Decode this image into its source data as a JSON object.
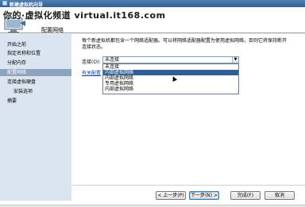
{
  "window": {
    "title": "新建虚拟机向导"
  },
  "header": {
    "title": "配置网络"
  },
  "watermark": {
    "text": "你的·虚拟化频道 virtual.it168.com"
  },
  "sidebar": {
    "items": [
      {
        "label": "开始之前"
      },
      {
        "label": "指定名称和位置"
      },
      {
        "label": "分配内存"
      },
      {
        "label": "配置网络"
      },
      {
        "label": "连接虚拟硬盘"
      },
      {
        "label": "安装选项"
      },
      {
        "label": "摘要"
      }
    ]
  },
  "content": {
    "description": "每个新虚拟机都包含一个网络适配器。可以将网络适配器配置为使用虚拟网络，否则它将保持断开连接状态。",
    "connection_label": "连接(O):",
    "connection_value": "未连接",
    "link_text": "有关配置",
    "dropdown_options": [
      {
        "label": "未连接"
      },
      {
        "label": "内部虚拟网络"
      },
      {
        "label": "内部虚拟网络"
      },
      {
        "label": "专用虚拟网络"
      },
      {
        "label": "内部虚拟网络"
      }
    ]
  },
  "footer": {
    "prev_label": "< 上一步(P)",
    "next_label": "下一步(N) >",
    "finish_label": "完成(F)",
    "cancel_label": "取消"
  },
  "colors": {
    "sidebar_bg": "#dbe5f1",
    "sidebar_active": "#8ea3bd",
    "titlebar": "#2f5f95",
    "selection": "#2f5f95"
  }
}
